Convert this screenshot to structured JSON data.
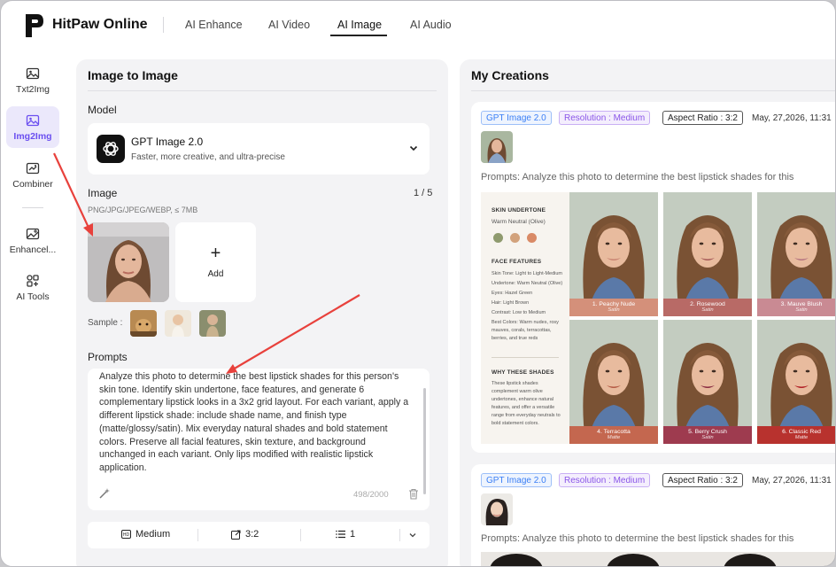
{
  "app": {
    "brand": "HitPaw Online"
  },
  "nav": {
    "tabs": [
      {
        "label": "AI Enhance"
      },
      {
        "label": "AI Video"
      },
      {
        "label": "AI Image",
        "active": true
      },
      {
        "label": "AI Audio"
      }
    ]
  },
  "rail": {
    "items": [
      {
        "label": "Txt2Img",
        "icon": "image-icon"
      },
      {
        "label": "Img2Img",
        "icon": "image-icon",
        "active": true
      },
      {
        "label": "Combiner",
        "icon": "combiner-icon"
      },
      {
        "label": "Enhancel...",
        "icon": "enhance-icon"
      },
      {
        "label": "AI Tools",
        "icon": "tools-icon"
      }
    ]
  },
  "left": {
    "title": "Image to Image",
    "model_label": "Model",
    "model_name": "GPT Image 2.0",
    "model_desc": "Faster, more creative, and ultra-precise",
    "image_label": "Image",
    "image_count": "1 / 5",
    "image_hint": "PNG/JPG/JPEG/WEBP, ≤ 7MB",
    "add_label": "Add",
    "sample_label": "Sample :",
    "prompts_label": "Prompts",
    "prompt_text": "Analyze this photo to determine the best lipstick shades for this person's skin tone. Identify skin undertone, face features, and generate 6 complementary lipstick looks in a 3x2 grid layout. For each variant, apply a different lipstick shade: include shade name, and finish type (matte/glossy/satin). Mix everyday natural shades and bold statement colors. Preserve all facial features, skin texture, and background unchanged in each variant. Only lips modified with realistic lipstick application.",
    "char_count": "498/2000",
    "quality": "Medium",
    "ratio": "3:2",
    "quantity": "1"
  },
  "right": {
    "title": "My Creations",
    "cards": [
      {
        "model_tag": "GPT Image 2.0",
        "resolution_tag": "Resolution : Medium",
        "ratio_tag": "Aspect Ratio : 3:2",
        "date": "May, 27,2026, 11:31",
        "prompt": "Prompts: Analyze this photo to determine the best lipstick shades for this"
      },
      {
        "model_tag": "GPT Image 2.0",
        "resolution_tag": "Resolution : Medium",
        "ratio_tag": "Aspect Ratio : 3:2",
        "date": "May, 27,2026, 11:31",
        "prompt": "Prompts: Analyze this photo to determine the best lipstick shades for this"
      }
    ],
    "result": {
      "undertone_h": "SKIN UNDERTONE",
      "undertone_v": "Warm Neutral (Olive)",
      "swatches": [
        "#8f9a6e",
        "#d2a27c",
        "#d98a66"
      ],
      "features_h": "FACE FEATURES",
      "features": [
        "Skin Tone: Light to Light-Medium",
        "Undertone: Warm Neutral (Olive)",
        "Eyes: Hazel Green",
        "Hair: Light Brown",
        "Contrast: Low to Medium",
        "Best Colors: Warm nudes, rosy mauves, corals, terracottas, berries, and true reds"
      ],
      "why_h": "WHY THESE SHADES",
      "why": "These lipstick shades complement warm olive undertones, enhance natural features, and offer a versatile range from everyday neutrals to bold statement colors.",
      "shades": [
        {
          "name": "1. Peachy Nude",
          "finish": "Satin",
          "color": "#d4907a",
          "lip": "#c98472"
        },
        {
          "name": "2. Rosewood",
          "finish": "Satin",
          "color": "#b86a66",
          "lip": "#a65a58"
        },
        {
          "name": "3. Mauve Blush",
          "finish": "Satin",
          "color": "#c98a93",
          "lip": "#b57480"
        },
        {
          "name": "4. Terracotta",
          "finish": "Matte",
          "color": "#c4674f",
          "lip": "#b45a44"
        },
        {
          "name": "5. Berry Crush",
          "finish": "Satin",
          "color": "#9e3b4f",
          "lip": "#8a2c42"
        },
        {
          "name": "6. Classic Red",
          "finish": "Matte",
          "color": "#b8322e",
          "lip": "#b01e24"
        }
      ]
    }
  },
  "colors": {
    "accent": "#6b4ff0",
    "arrow": "#e8413c"
  }
}
